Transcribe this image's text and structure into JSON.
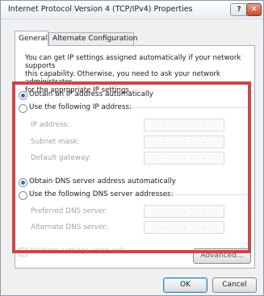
{
  "window": {
    "title": "Internet Protocol Version 4 (TCP/IPv4) Properties"
  },
  "titlebar": {
    "help": "?",
    "close": "✕"
  },
  "tabs": [
    {
      "label": "General"
    },
    {
      "label": "Alternate Configuration"
    }
  ],
  "intro": {
    "line1": "You can get IP settings assigned automatically if your network supports",
    "line2": "this capability. Otherwise, you need to ask your network administrator",
    "line3": "for the appropriate IP settings."
  },
  "ip": {
    "auto_label": "Obtain an IP address automatically",
    "manual_label": "Use the following IP address:",
    "selected": "auto",
    "fields": [
      {
        "label": "IP address:",
        "value": ""
      },
      {
        "label": "Subnet mask:",
        "value": ""
      },
      {
        "label": "Default gateway:",
        "value": ""
      }
    ]
  },
  "dns": {
    "auto_label": "Obtain DNS server address automatically",
    "manual_label": "Use the following DNS server addresses:",
    "selected": "auto",
    "fields": [
      {
        "label": "Preferred DNS server:",
        "value": ""
      },
      {
        "label": "Alternate DNS server:",
        "value": ""
      }
    ]
  },
  "footer": {
    "validate_label": "Validate settings upon exit",
    "advanced_label": "Advanced...",
    "ok_label": "OK",
    "cancel_label": "Cancel"
  },
  "colors": {
    "highlight": "#c74848",
    "accent": "#2b6cc4"
  }
}
